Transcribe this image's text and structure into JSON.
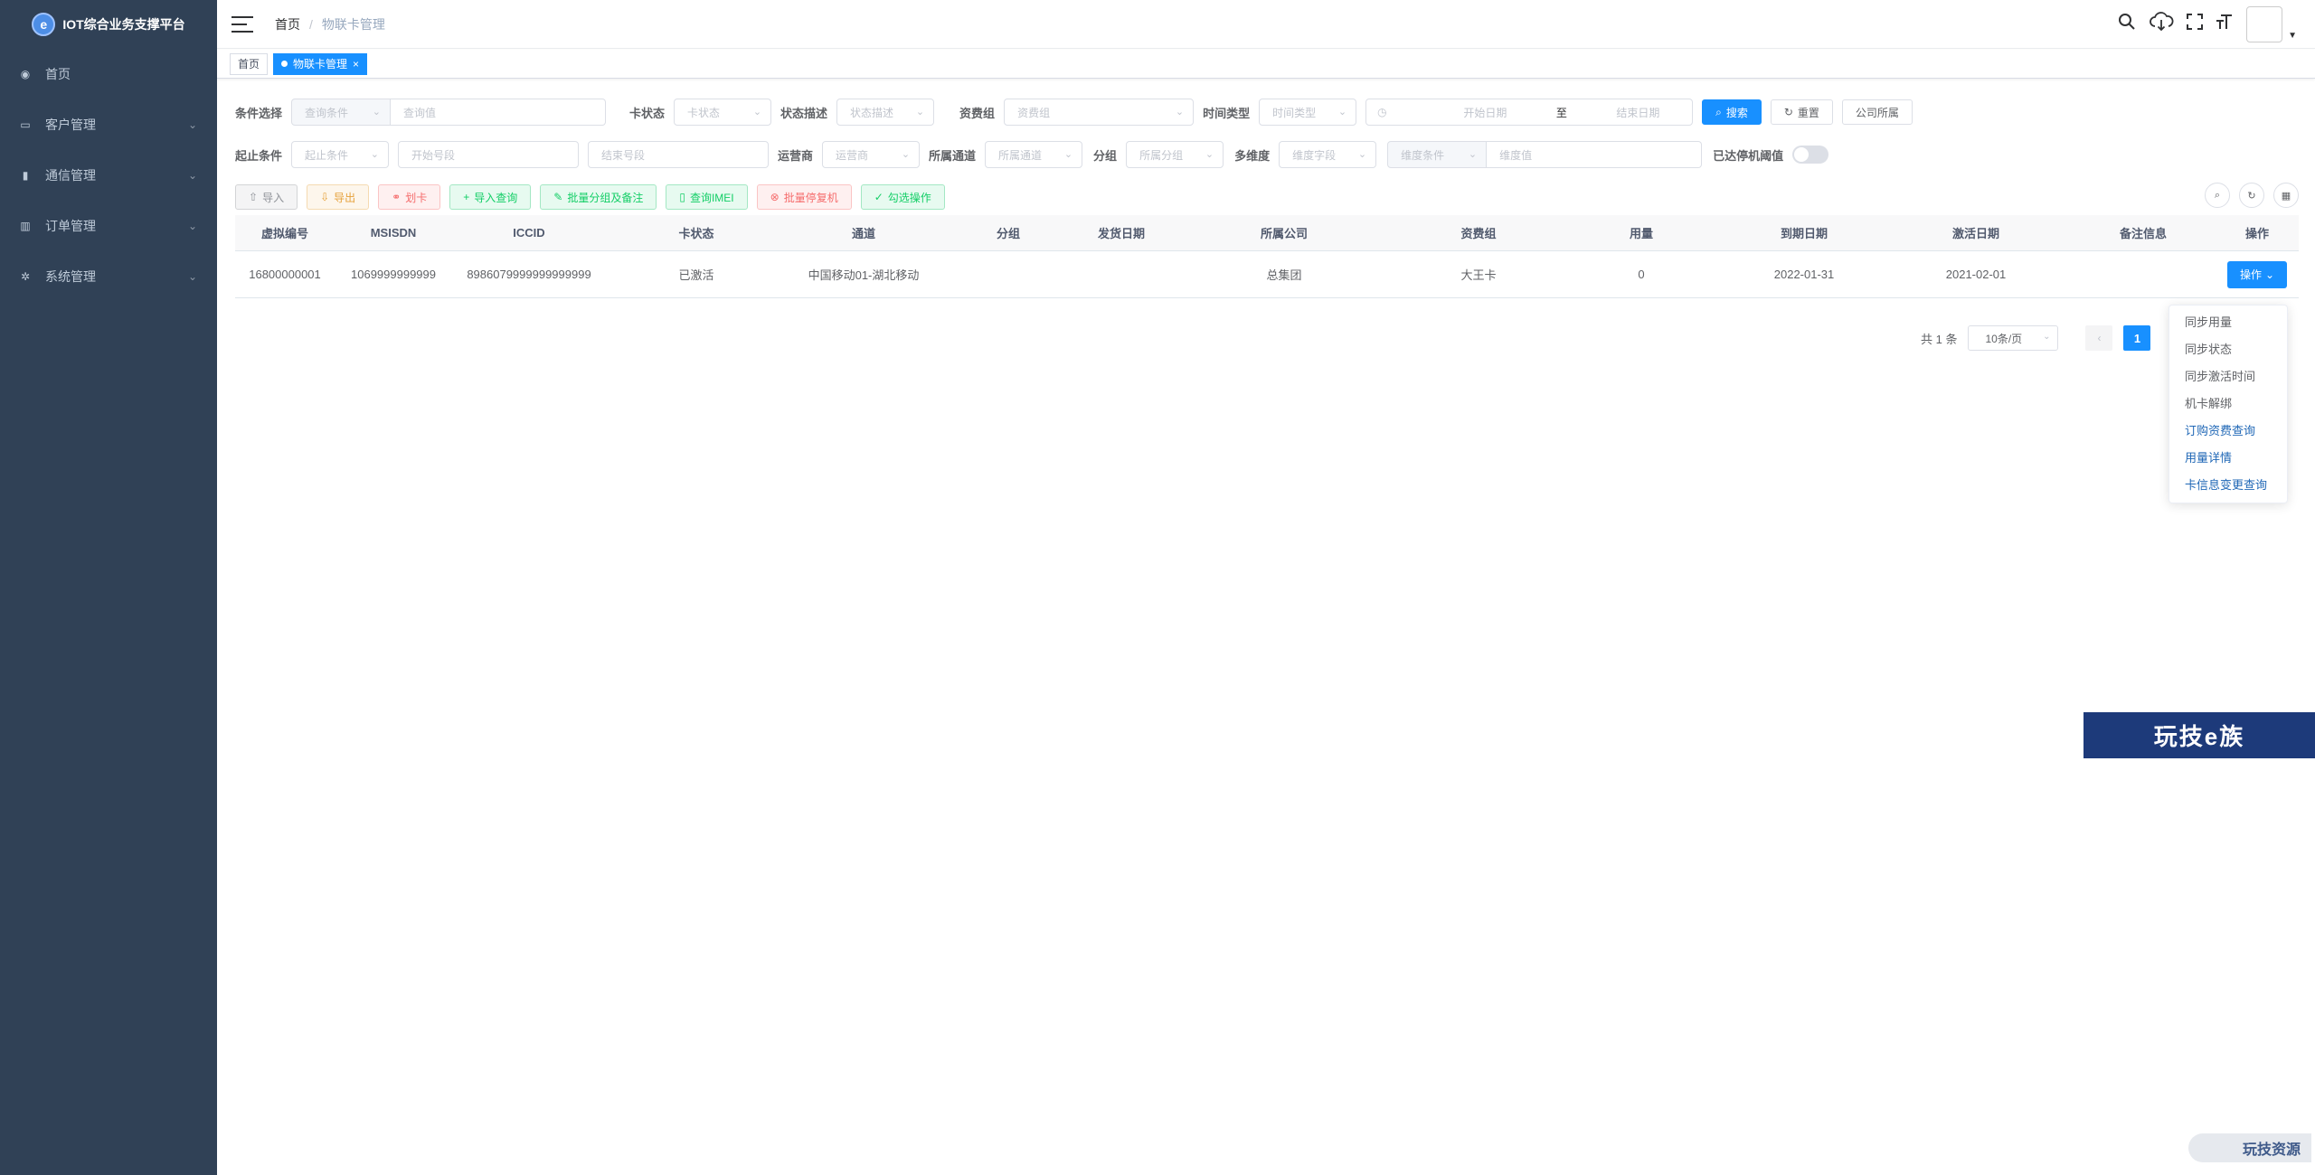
{
  "app": {
    "title": "IOT综合业务支撑平台",
    "logo_icon": "e-logo-icon"
  },
  "sidebar": {
    "items": [
      {
        "label": "首页",
        "icon": "dashboard-icon",
        "expandable": false
      },
      {
        "label": "客户管理",
        "icon": "monitor-icon",
        "expandable": true
      },
      {
        "label": "通信管理",
        "icon": "card-icon",
        "expandable": true
      },
      {
        "label": "订单管理",
        "icon": "bar-chart-icon",
        "expandable": true
      },
      {
        "label": "系统管理",
        "icon": "gear-icon",
        "expandable": true
      }
    ]
  },
  "header": {
    "breadcrumb": {
      "home": "首页",
      "sep": "/",
      "current": "物联卡管理"
    }
  },
  "tags": {
    "home": "首页",
    "active": "物联卡管理",
    "close": "×"
  },
  "filters": {
    "row1": {
      "cond_label": "条件选择",
      "cond_placeholder": "查询条件",
      "query_placeholder": "查询值",
      "card_status_label": "卡状态",
      "card_status_placeholder": "卡状态",
      "status_desc_label": "状态描述",
      "status_desc_placeholder": "状态描述",
      "tariff_label": "资费组",
      "tariff_placeholder": "资费组",
      "time_type_label": "时间类型",
      "time_type_placeholder": "时间类型",
      "start_date_placeholder": "开始日期",
      "range_sep": "至",
      "end_date_placeholder": "结束日期",
      "search_btn": "搜索",
      "reset_btn": "重置",
      "company_btn": "公司所属"
    },
    "row2": {
      "range_label": "起止条件",
      "range_placeholder": "起止条件",
      "start_no_placeholder": "开始号段",
      "end_no_placeholder": "结束号段",
      "operator_label": "运营商",
      "operator_placeholder": "运营商",
      "channel_label": "所属通道",
      "channel_placeholder": "所属通道",
      "group_label": "分组",
      "group_placeholder": "所属分组",
      "dimension_label": "多维度",
      "dimension_placeholder": "维度字段",
      "dim_cond_placeholder": "维度条件",
      "dim_value_placeholder": "维度值",
      "threshold_label": "已达停机阈值"
    }
  },
  "actions": {
    "import": "导入",
    "export": "导出",
    "assign": "划卡",
    "import_query": "导入查询",
    "batch_group": "批量分组及备注",
    "query_imei": "查询IMEI",
    "batch_stop": "批量停复机",
    "check_op": "勾选操作"
  },
  "table": {
    "columns": [
      "虚拟编号",
      "MSISDN",
      "ICCID",
      "卡状态",
      "通道",
      "分组",
      "发货日期",
      "所属公司",
      "资费组",
      "用量",
      "到期日期",
      "激活日期",
      "备注信息",
      "操作"
    ],
    "rows": [
      [
        "16800000001",
        "1069999999999",
        "8986079999999999999",
        "已激活",
        "中国移动01-湖北移动",
        "",
        "",
        "总集团",
        "大王卡",
        "0",
        "2022-01-31",
        "2021-02-01",
        "",
        "操作"
      ]
    ]
  },
  "pagination": {
    "total": "共 1 条",
    "page_size": "10条/页",
    "current": "1"
  },
  "dropdown": {
    "items": [
      "同步用量",
      "同步状态",
      "同步激活时间",
      "机卡解绑",
      "订购资费查询",
      "用量详情",
      "卡信息变更查询"
    ]
  },
  "watermarks": {
    "banner": "玩技e族",
    "corner": "玩技资源"
  },
  "colors": {
    "sidebar": "#304156",
    "primary": "#1890ff",
    "link": "#337ab7"
  }
}
